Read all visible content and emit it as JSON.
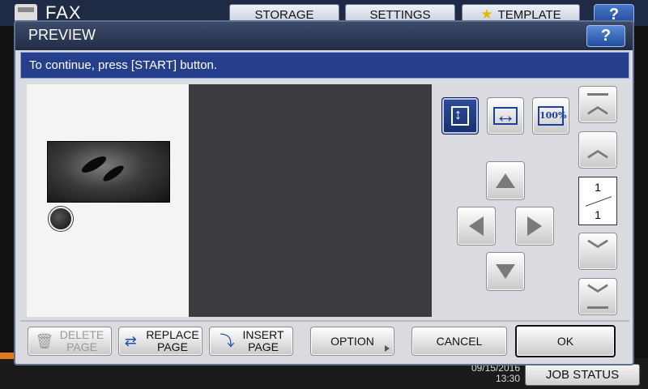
{
  "app": {
    "title": "FAX",
    "tabs": [
      {
        "label": "STORAGE"
      },
      {
        "label": "SETTINGS"
      },
      {
        "label": "TEMPLATE"
      }
    ],
    "help_label": "?",
    "clock_date": "09/15/2016",
    "clock_time": "13:30",
    "job_status_label": "JOB STATUS"
  },
  "dialog": {
    "title": "PREVIEW",
    "help_label": "?",
    "message": "To continue, press [START] button.",
    "zoom_buttons": [
      {
        "name": "fit-page",
        "selected": true
      },
      {
        "name": "fit-width",
        "selected": false
      },
      {
        "name": "actual-size",
        "label": "100%",
        "selected": false
      }
    ],
    "page_indicator": {
      "current": "1",
      "total": "1"
    },
    "bottom_buttons": {
      "delete_line1": "DELETE",
      "delete_line2": "PAGE",
      "replace_line1": "REPLACE",
      "replace_line2": "PAGE",
      "insert_line1": "INSERT",
      "insert_line2": "PAGE",
      "option": "OPTION",
      "cancel": "CANCEL",
      "ok": "OK"
    }
  },
  "colors": {
    "title_bar": "#2a3450",
    "message_bar": "#253f8c",
    "selected_button": "#1f3a80",
    "preview_area": "#3b3b40"
  }
}
